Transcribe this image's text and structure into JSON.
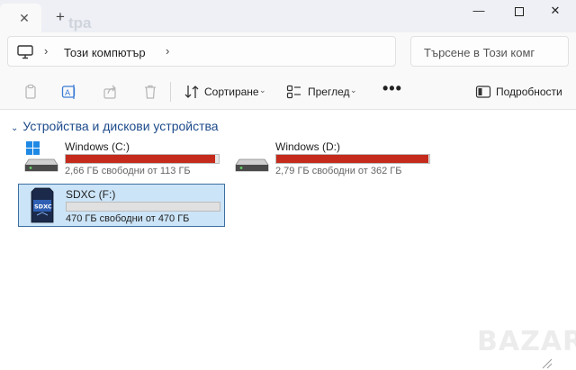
{
  "tabs": {
    "close_icon": "close-icon",
    "add_icon": "plus-icon",
    "ghost_text": "tpa"
  },
  "window": {
    "minimize_glyph": "—",
    "close_glyph": "✕"
  },
  "address": {
    "location_icon": "computer-icon",
    "chevron": "›",
    "crumb": "Този компютър",
    "search_placeholder": "Търсене в Този комг"
  },
  "commands": {
    "sort_label": "Сортиране",
    "view_label": "Преглед",
    "more_label": "•••",
    "details_label": "Подробности",
    "dropdown_glyph": "⌄"
  },
  "group": {
    "chevron": "⌄",
    "title": "Устройства и дискови устройства"
  },
  "drives": [
    {
      "name": "Windows (C:)",
      "free_text": "2,66 ГБ свободни от 113 ГБ",
      "used_fraction": 0.976,
      "bar_color": "#c42b1c",
      "icon": "windows-drive-icon"
    },
    {
      "name": "Windows  (D:)",
      "free_text": "2,79 ГБ свободни от 362 ГБ",
      "used_fraction": 0.992,
      "bar_color": "#c42b1c",
      "icon": "hard-drive-icon"
    },
    {
      "name": "SDXC (F:)",
      "free_text": "470 ГБ свободни от 470 ГБ",
      "used_fraction": 0.0,
      "bar_color": "#26a0da",
      "icon": "sd-card-icon",
      "selected": true,
      "card_label": "SDXC"
    }
  ],
  "watermark": "BAZAR"
}
